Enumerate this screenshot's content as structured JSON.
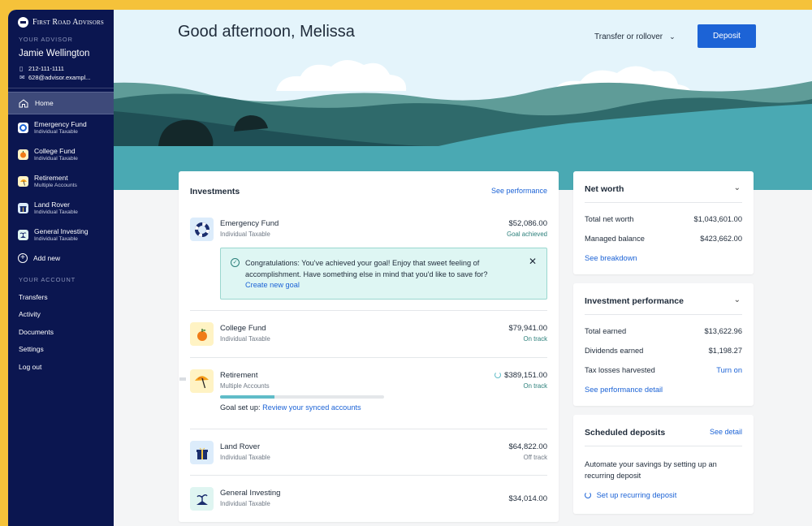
{
  "brand": {
    "name": "First Road Advisors"
  },
  "sidebar": {
    "advisor_label": "YOUR ADVISOR",
    "advisor_name": "Jamie Wellington",
    "phone": "212-111-1111",
    "email": "628@advisor.exampl...",
    "home_label": "Home",
    "accounts": [
      {
        "name": "Emergency Fund",
        "sub": "Individual Taxable",
        "icon": "lifebuoy-icon",
        "color": "#ffffff"
      },
      {
        "name": "College Fund",
        "sub": "Individual Taxable",
        "icon": "apple-icon",
        "color": "#fff3c4"
      },
      {
        "name": "Retirement",
        "sub": "Multiple Accounts",
        "icon": "umbrella-icon",
        "color": "#fff3c4"
      },
      {
        "name": "Land Rover",
        "sub": "Individual Taxable",
        "icon": "gift-icon",
        "color": "#dcecfb"
      },
      {
        "name": "General Investing",
        "sub": "Individual Taxable",
        "icon": "sprout-icon",
        "color": "#dff5f1"
      }
    ],
    "add_new": "Add new",
    "your_account_label": "YOUR ACCOUNT",
    "links": [
      "Transfers",
      "Activity",
      "Documents",
      "Settings",
      "Log out"
    ]
  },
  "header": {
    "greeting": "Good afternoon, Melissa",
    "transfer_label": "Transfer or rollover",
    "deposit_label": "Deposit"
  },
  "investments": {
    "title": "Investments",
    "see_performance": "See performance",
    "rows": [
      {
        "name": "Emergency Fund",
        "sub": "Individual Taxable",
        "amount": "$52,086.00",
        "status": "Goal achieved"
      },
      {
        "name": "College Fund",
        "sub": "Individual Taxable",
        "amount": "$79,941.00",
        "status": "On track"
      },
      {
        "name": "Retirement",
        "sub": "Multiple Accounts",
        "amount": "$389,151.00",
        "status": "On track"
      },
      {
        "name": "Land Rover",
        "sub": "Individual Taxable",
        "amount": "$64,822.00",
        "status": "Off track"
      },
      {
        "name": "General Investing",
        "sub": "Individual Taxable",
        "amount": "$34,014.00",
        "status": ""
      }
    ],
    "congrats": {
      "message": "Congratulations: You've achieved your goal! Enjoy that sweet feeling of accomplishment. Have something else in mind that you'd like to save for?",
      "link": "Create new goal"
    },
    "retirement_progress": 0.33,
    "goal_setup_prefix": "Goal set up:",
    "goal_setup_link": "Review your synced accounts"
  },
  "net_worth": {
    "title": "Net worth",
    "items": [
      {
        "label": "Total net worth",
        "value": "$1,043,601.00"
      },
      {
        "label": "Managed balance",
        "value": "$423,662.00"
      }
    ],
    "link": "See breakdown"
  },
  "performance": {
    "title": "Investment performance",
    "items": [
      {
        "label": "Total earned",
        "value": "$13,622.96"
      },
      {
        "label": "Dividends earned",
        "value": "$1,198.27"
      },
      {
        "label": "Tax losses harvested",
        "value": "Turn on"
      }
    ],
    "link": "See performance detail"
  },
  "scheduled": {
    "title": "Scheduled deposits",
    "see_detail": "See detail",
    "text": "Automate your savings by setting up an recurring deposit",
    "link": "Set up recurring deposit"
  },
  "colors": {
    "sidebar": "#0b1650",
    "accent": "#1c63d6",
    "page_bg": "#f5c23a"
  }
}
